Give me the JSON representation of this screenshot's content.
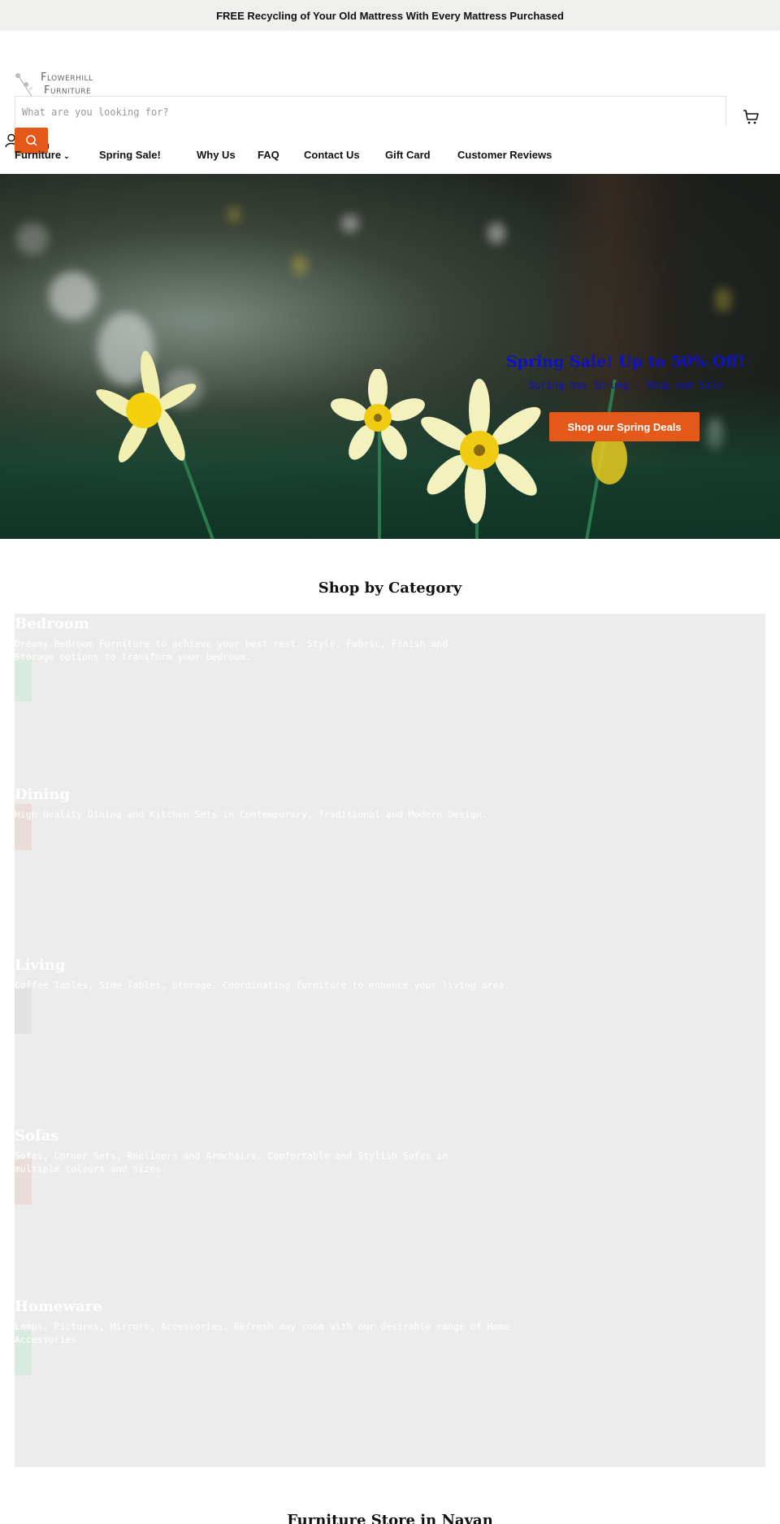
{
  "announcement": "FREE Recycling of Your Old Mattress With Every Mattress Purchased",
  "header": {
    "logo_line1": "Flowerhill",
    "logo_line2": "Furniture",
    "search_placeholder": "What are you looking for?",
    "search_value": "",
    "search_button_icon": "search-icon",
    "account_icon": "user-icon",
    "account_label_visible": "n",
    "cart_icon": "cart-icon"
  },
  "nav": {
    "items": [
      {
        "label": "Furniture",
        "has_dropdown": true
      },
      {
        "label": "Spring Sale!"
      },
      {
        "label": "Why Us"
      },
      {
        "label": "FAQ"
      },
      {
        "label": "Contact Us"
      },
      {
        "label": "Gift Card"
      },
      {
        "label": "Customer Reviews"
      }
    ],
    "dropdown_glyph": "⌄"
  },
  "hero": {
    "title": "Spring Sale! Up to 50% Off!",
    "subtitle": "Spring has Sprung - Shop our Sale",
    "button_label": "Shop our Spring Deals"
  },
  "categories_section": {
    "title": "Shop by Category",
    "items": [
      {
        "title": "Bedroom",
        "description": "Dreamy Bedroom Furniture to achieve your best rest. Style, Fabric, Finish and Storage options to transform your bedroom.",
        "swatch_color": "#d9eadf"
      },
      {
        "title": "Dining",
        "description": "High Quality Dining and Kitchen Sets in Contemporary, Traditional and Modern Design.",
        "swatch_color": "#eadcd6"
      },
      {
        "title": "Living",
        "description": "Coffee Tables, Side Tables, Storage. Coordinating furniture to enhance your living area.",
        "swatch_color": "#e2e2e2"
      },
      {
        "title": "Sofas",
        "description": "Sofas, Corner Sets, Recliners and Armchairs. Comfortable and Stylish Sofas in multiple colours and sizes",
        "swatch_color": "#eadcd6"
      },
      {
        "title": "Homeware",
        "description": "Lamps, Pictures, Mirrors, Accessories. Refresh any room with our desirable range of Home Accessories",
        "swatch_color": "#d9eadf"
      }
    ]
  },
  "store_section": {
    "title": "Furniture Store in Navan"
  },
  "colors": {
    "accent": "#e4591a",
    "hero_text": "#1010c8",
    "announcement_bg": "#efefed",
    "category_panel_bg": "#ececec"
  }
}
